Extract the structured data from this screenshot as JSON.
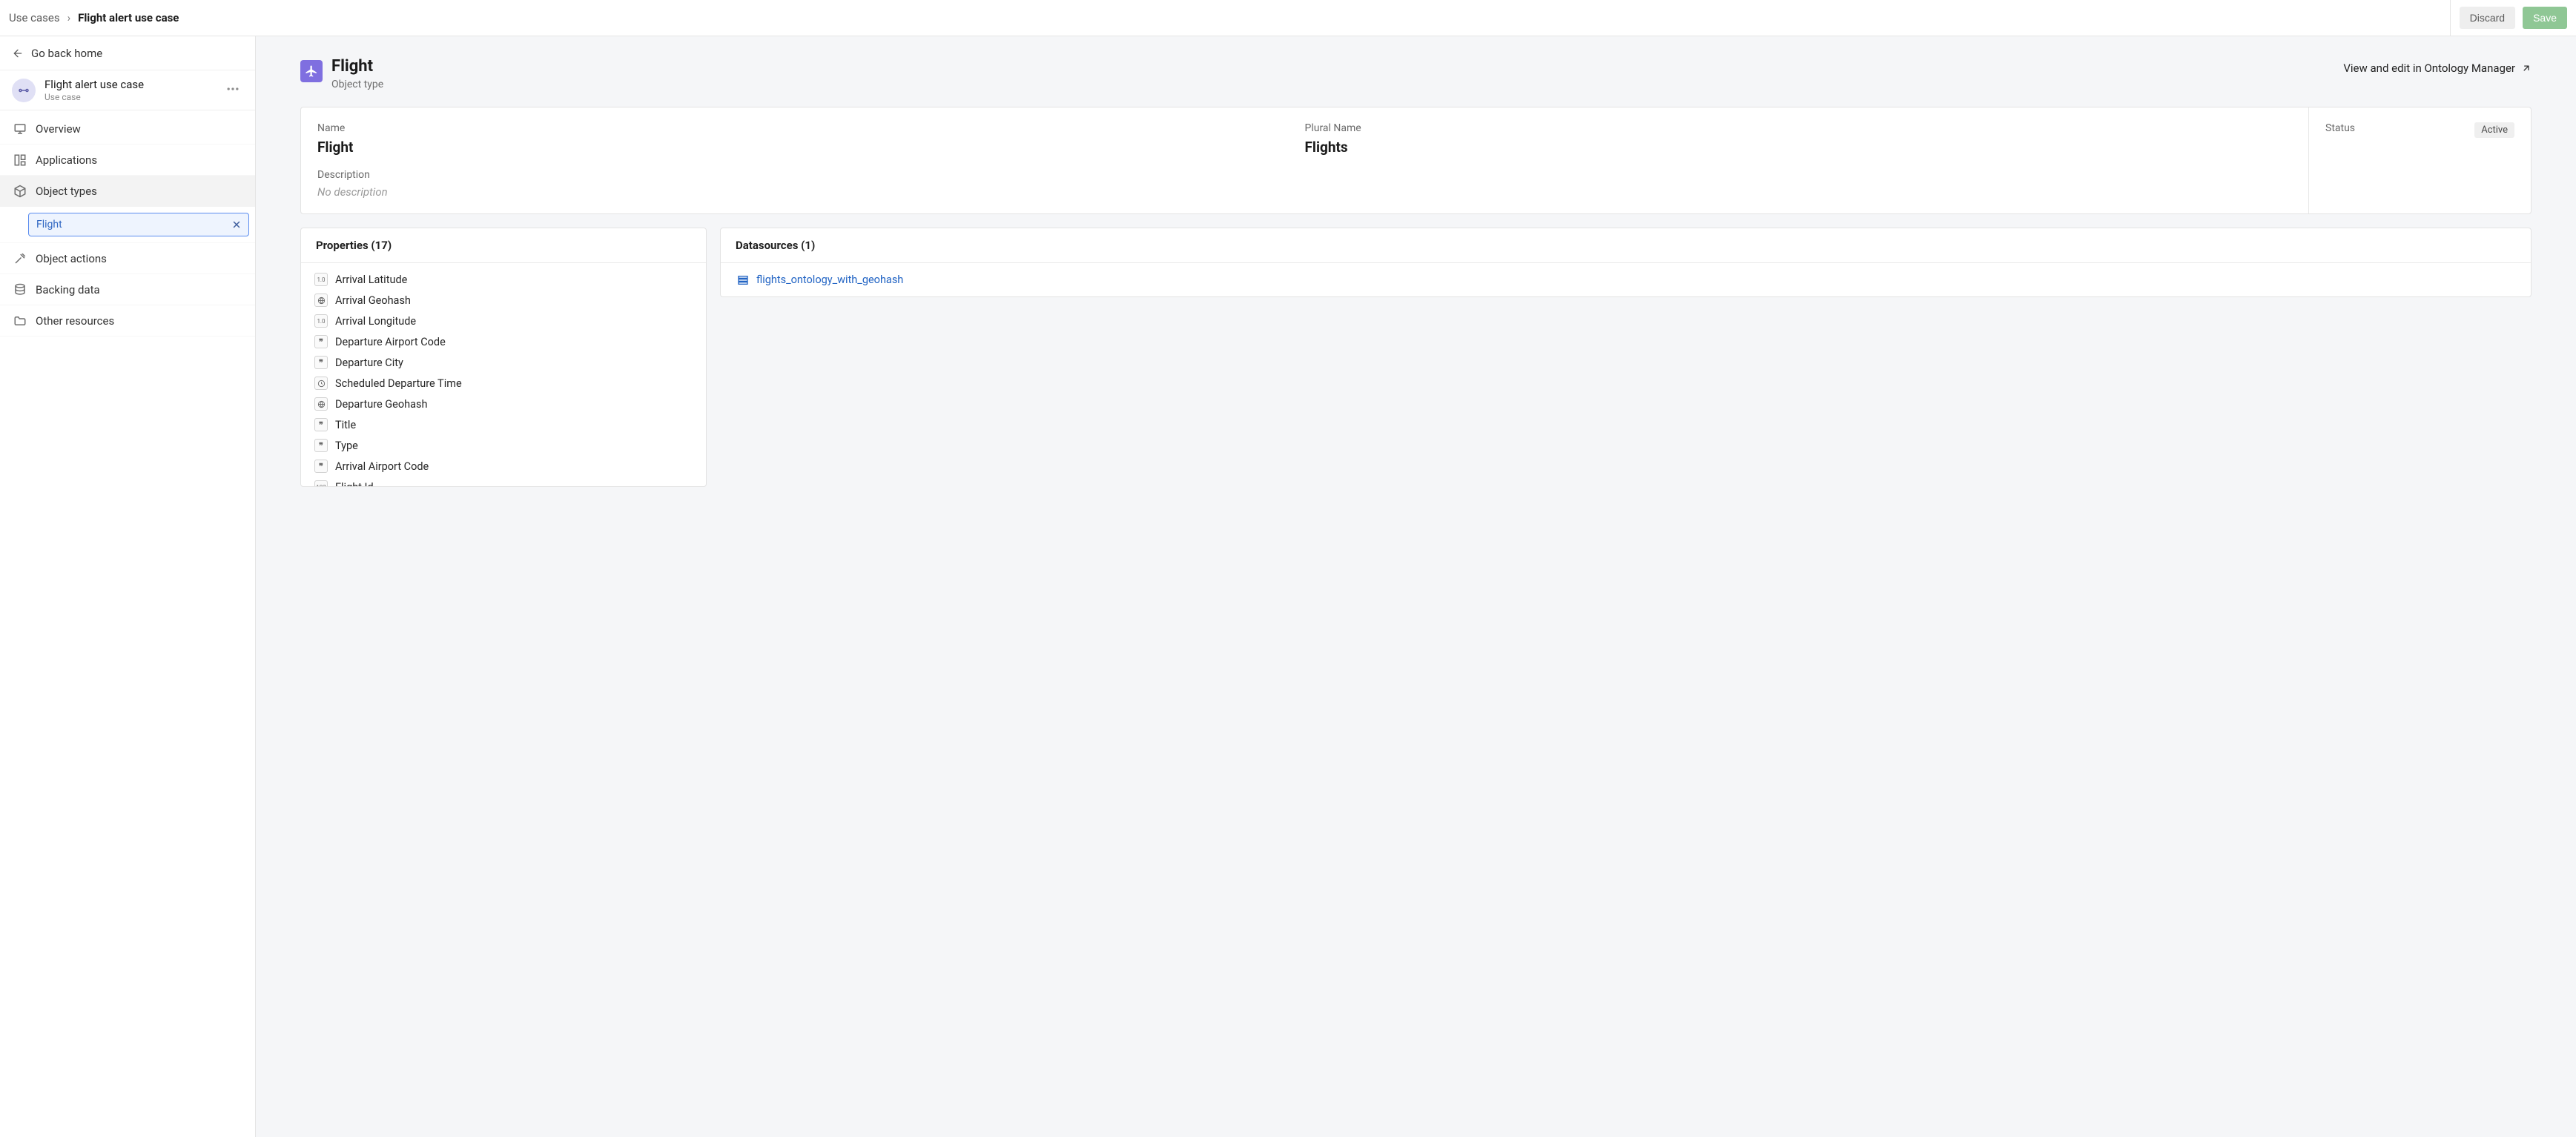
{
  "breadcrumbs": {
    "root": "Use cases",
    "current": "Flight alert use case"
  },
  "topbar": {
    "discard": "Discard",
    "save": "Save"
  },
  "sidebar": {
    "go_back": "Go back home",
    "usecase": {
      "title": "Flight alert use case",
      "subtitle": "Use case"
    },
    "nav": {
      "overview": "Overview",
      "applications": "Applications",
      "object_types": "Object types",
      "object_actions": "Object actions",
      "backing_data": "Backing data",
      "other_resources": "Other resources"
    },
    "selected_object": "Flight"
  },
  "main": {
    "title": "Flight",
    "subtitle": "Object type",
    "ontology_link": "View and edit in Ontology Manager",
    "meta": {
      "name_label": "Name",
      "name_value": "Flight",
      "plural_label": "Plural Name",
      "plural_value": "Flights",
      "description_label": "Description",
      "description_value": "No description",
      "status_label": "Status",
      "status_value": "Active"
    },
    "properties": {
      "header": "Properties (17)",
      "items": [
        {
          "type": "float",
          "label": "Arrival Latitude"
        },
        {
          "type": "geo",
          "label": "Arrival Geohash"
        },
        {
          "type": "float",
          "label": "Arrival Longitude"
        },
        {
          "type": "string",
          "label": "Departure Airport Code"
        },
        {
          "type": "string",
          "label": "Departure City"
        },
        {
          "type": "time",
          "label": "Scheduled Departure Time"
        },
        {
          "type": "geo",
          "label": "Departure Geohash"
        },
        {
          "type": "string",
          "label": "Title"
        },
        {
          "type": "string",
          "label": "Type"
        },
        {
          "type": "string",
          "label": "Arrival Airport Code"
        },
        {
          "type": "int",
          "label": "Flight Id"
        }
      ]
    },
    "datasources": {
      "header": "Datasources (1)",
      "items": [
        {
          "label": "flights_ontology_with_geohash"
        }
      ]
    }
  }
}
